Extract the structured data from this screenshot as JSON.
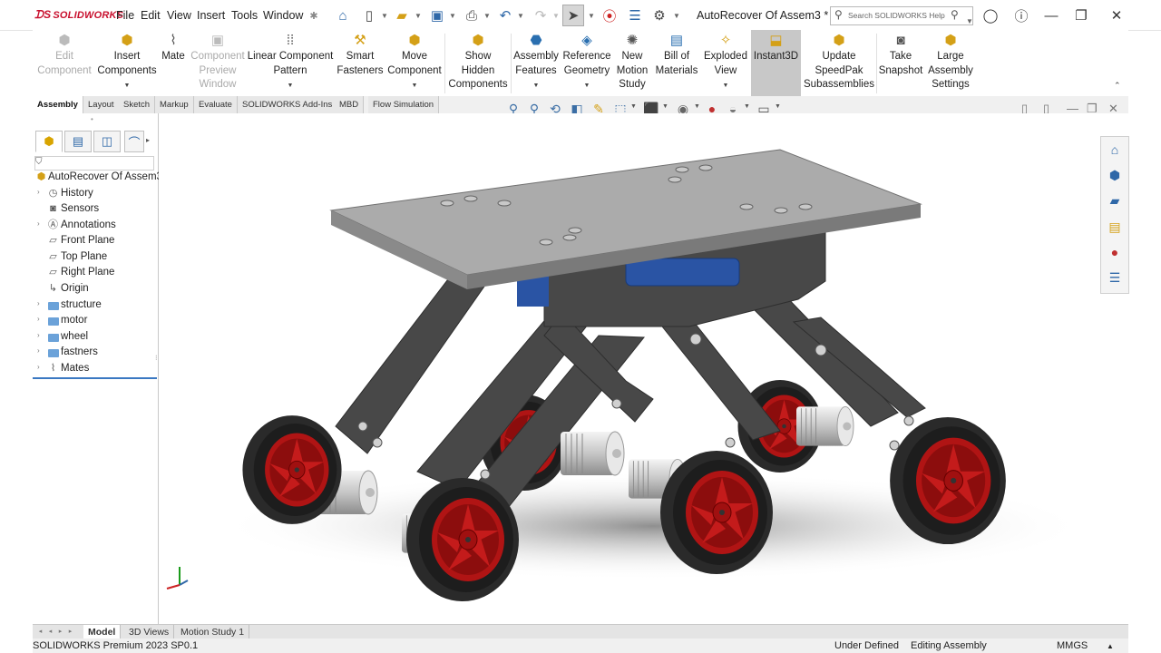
{
  "app": {
    "brand": "SOLIDWORKS",
    "doc_title": "AutoRecover Of Assem3 *"
  },
  "menu": [
    "File",
    "Edit",
    "View",
    "Insert",
    "Tools",
    "Window"
  ],
  "search": {
    "placeholder": "Search SOLIDWORKS Help"
  },
  "ribbon": {
    "edit_component": "Edit\nComponent",
    "insert_components": "Insert\nComponents",
    "mate": "Mate",
    "component_preview": "Component\nPreview\nWindow",
    "linear_pattern": "Linear Component\nPattern",
    "smart_fasteners": "Smart\nFasteners",
    "move_component": "Move\nComponent",
    "show_hidden": "Show\nHidden\nComponents",
    "assembly_features": "Assembly\nFeatures",
    "reference_geometry": "Reference\nGeometry",
    "new_motion_study": "New\nMotion\nStudy",
    "bill_of_materials": "Bill of\nMaterials",
    "exploded_view": "Exploded\nView",
    "instant3d": "Instant3D",
    "update_speedpak": "Update\nSpeedPak\nSubassemblies",
    "take_snapshot": "Take\nSnapshot",
    "large_assembly": "Large\nAssembly\nSettings"
  },
  "command_tabs": [
    "Assembly",
    "Layout",
    "Sketch",
    "Markup",
    "Evaluate",
    "SOLIDWORKS Add-Ins",
    "MBD",
    "Flow Simulation"
  ],
  "tree": {
    "root": "AutoRecover Of Assem3",
    "items": [
      {
        "label": "History"
      },
      {
        "label": "Sensors"
      },
      {
        "label": "Annotations"
      },
      {
        "label": "Front Plane"
      },
      {
        "label": "Top Plane"
      },
      {
        "label": "Right Plane"
      },
      {
        "label": "Origin"
      },
      {
        "label": "structure"
      },
      {
        "label": "motor"
      },
      {
        "label": "wheel"
      },
      {
        "label": "fastners"
      },
      {
        "label": "Mates"
      }
    ]
  },
  "bottom_tabs": [
    "Model",
    "3D Views",
    "Motion Study 1"
  ],
  "status": {
    "product": "SOLIDWORKS Premium 2023 SP0.1",
    "state": "Under Defined",
    "mode": "Editing Assembly",
    "units": "MMGS"
  },
  "colors": {
    "wheel_red": "#b01414",
    "tire": "#2a2a2a",
    "plate": "#a9a9a9",
    "frame": "#4a4a4a",
    "accent_blue": "#2f68a8"
  }
}
